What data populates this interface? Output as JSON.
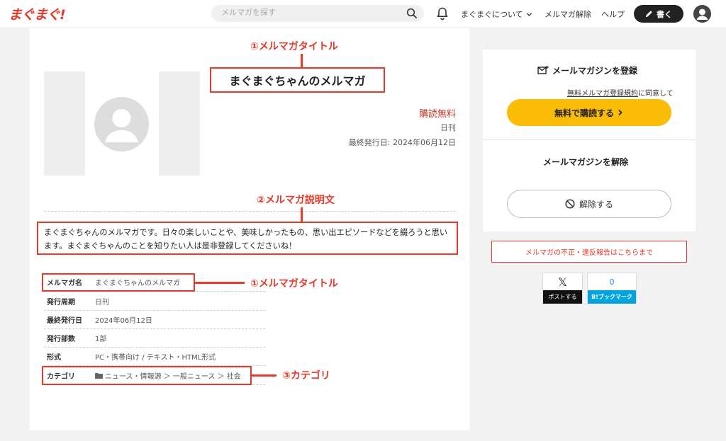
{
  "header": {
    "logo": "まぐまぐ!",
    "search_placeholder": "メルマガを探す",
    "nav_about": "まぐまぐについて",
    "nav_unsubscribe": "メルマガ解除",
    "nav_help": "ヘルプ",
    "write_label": "書く"
  },
  "annotations": {
    "title": "①メルマガタイトル",
    "description": "②メルマガ説明文",
    "table_title": "①メルマガタイトル",
    "category": "③カテゴリ"
  },
  "magazine": {
    "title": "まぐまぐちゃんのメルマガ",
    "price": "購読無料",
    "frequency": "日刊",
    "last_issue": "最終発行日: 2024年06月12日",
    "description": "まぐまぐちゃんのメルマガです。日々の楽しいことや、美味しかったもの、思い出エピソードなどを綴ろうと思います。まぐまぐちゃんのことを知りたい人は是非登録してくださいね！"
  },
  "info_table": [
    {
      "key": "メルマガ名",
      "value": "まぐまぐちゃんのメルマガ"
    },
    {
      "key": "発行周期",
      "value": "日刊"
    },
    {
      "key": "最終発行日",
      "value": "2024年06月12日"
    },
    {
      "key": "発行部数",
      "value": "1部"
    },
    {
      "key": "形式",
      "value": "PC・携帯向け / テキスト・HTML形式"
    },
    {
      "key": "カテゴリ",
      "value": "ニュース・情報源 ＞ 一般ニュース ＞ 社会"
    }
  ],
  "sidebar": {
    "register_title": "メールマガジンを登録",
    "agree_link": "無料メルマガ登録規約",
    "agree_suffix": "に同意して",
    "subscribe_button": "無料で購読する",
    "unsubscribe_title": "メールマガジンを解除",
    "unsubscribe_button": "解除する",
    "report_link": "メルマガの不正・違反報告はこちらまで",
    "x_label": "ポストする",
    "hatena_count": "0",
    "hatena_label": "B!ブックマーク"
  },
  "colors": {
    "accent": "#e8382a",
    "subscribe": "#fbbc05"
  }
}
